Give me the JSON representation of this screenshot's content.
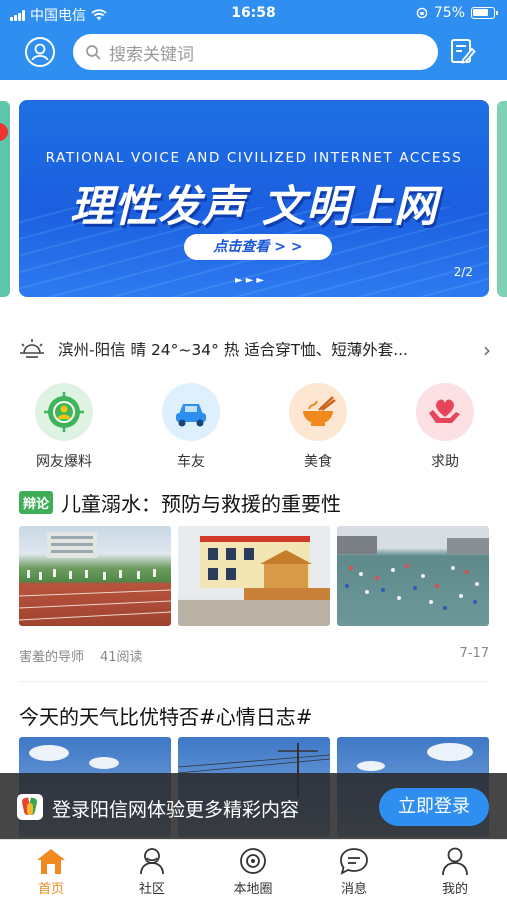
{
  "status_bar": {
    "carrier": "中国电信",
    "time": "16:58",
    "battery": "75%"
  },
  "search": {
    "placeholder": "搜索关键词"
  },
  "banner": {
    "english": "RATIONAL VOICE AND CIVILIZED INTERNET ACCESS",
    "chinese": "理性发声 文明上网",
    "cta": "点击查看 > >",
    "pager": "2/2"
  },
  "weather": {
    "text": "滨州-阳信 晴 24°~34° 热 适合穿T恤、短薄外套..."
  },
  "quick_links": [
    {
      "label": "网友爆料",
      "icon": "user-target-icon",
      "color": "#3fb55a"
    },
    {
      "label": "车友",
      "icon": "car-icon",
      "color": "#2f8ff0"
    },
    {
      "label": "美食",
      "icon": "noodle-bowl-icon",
      "color": "#f08a1f"
    },
    {
      "label": "求助",
      "icon": "hands-heart-icon",
      "color": "#e6455a"
    }
  ],
  "article1": {
    "tag": "辩论",
    "title": "儿童溺水：预防与救援的重要性",
    "author": "害羞的导师",
    "reads": "41阅读",
    "date": "7-17"
  },
  "article2": {
    "title": "今天的天气比优特否#心情日志#"
  },
  "login_prompt": {
    "message": "登录阳信网体验更多精彩内容",
    "button": "立即登录"
  },
  "tabbar": [
    {
      "label": "首页",
      "icon": "home-icon",
      "active": true
    },
    {
      "label": "社区",
      "icon": "community-icon",
      "active": false
    },
    {
      "label": "本地圈",
      "icon": "local-circle-icon",
      "active": false
    },
    {
      "label": "消息",
      "icon": "message-icon",
      "active": false
    },
    {
      "label": "我的",
      "icon": "profile-icon",
      "active": false
    }
  ],
  "colors": {
    "primary": "#2f8ff0",
    "active_tab": "#f08a1f",
    "tag": "#3fae58"
  }
}
